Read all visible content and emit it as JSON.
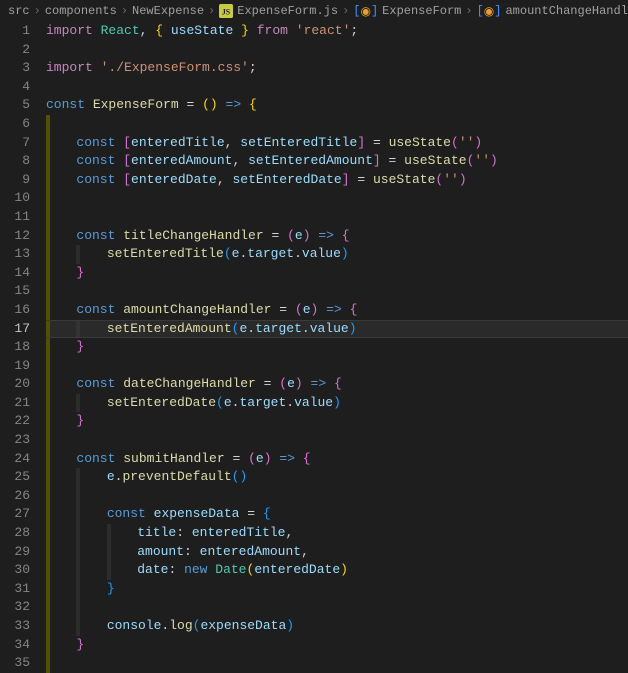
{
  "breadcrumb": {
    "items": [
      {
        "label": "src",
        "icon": ""
      },
      {
        "label": "components",
        "icon": ""
      },
      {
        "label": "NewExpense",
        "icon": ""
      },
      {
        "label": "ExpenseForm.js",
        "icon": "js"
      },
      {
        "label": "ExpenseForm",
        "icon": "sym"
      },
      {
        "label": "amountChangeHandler",
        "icon": "sym"
      }
    ]
  },
  "editor": {
    "current_line": 17,
    "line_count": 35
  },
  "code_text": "import React, { useState } from 'react';\n\nimport './ExpenseForm.css';\n\nconst ExpenseForm = () => {\n\n    const [enteredTitle, setEnteredTitle] = useState('')\n    const [enteredAmount, setEnteredAmount] = useState('')\n    const [enteredDate, setEnteredDate] = useState('')\n\n\n    const titleChangeHandler = (e) => {\n        setEnteredTitle(e.target.value)\n    }\n\n    const amountChangeHandler = (e) => {\n        setEnteredAmount(e.target.value)\n    }\n\n    const dateChangeHandler = (e) => {\n        setEnteredDate(e.target.value)\n    }\n\n    const submitHandler = (e) => {\n        e.preventDefault()\n\n        const expenseData = {\n            title: enteredTitle,\n            amount: enteredAmount,\n            date: new Date(enteredDate)\n        }\n\n        console.log(expenseData)\n    }\n"
}
